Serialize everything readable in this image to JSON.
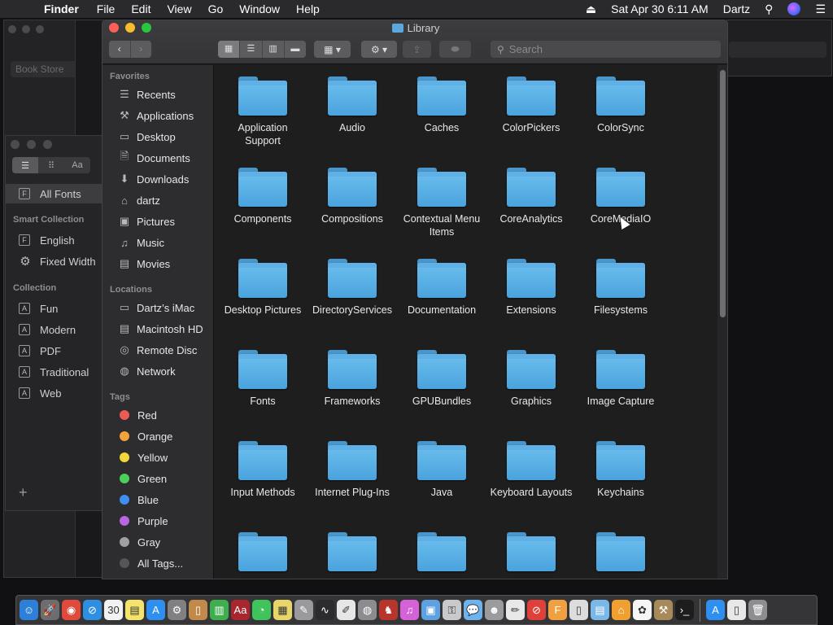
{
  "menubar": {
    "apple": "",
    "app_name": "Finder",
    "menus": [
      "File",
      "Edit",
      "View",
      "Go",
      "Window",
      "Help"
    ],
    "clock": "Sat Apr 30  6:11 AM",
    "user": "Dartz"
  },
  "bookstore": {
    "search_placeholder": "Book Store"
  },
  "fontbook": {
    "segments": [
      "☰",
      "⠿",
      "Aa"
    ],
    "all_fonts": "All Fonts",
    "smart_header": "Smart Collection",
    "smart_items": [
      "English",
      "Fixed Width"
    ],
    "collection_header": "Collection",
    "collection_items": [
      "Fun",
      "Modern",
      "PDF",
      "Traditional",
      "Web"
    ],
    "add": "+"
  },
  "finder": {
    "title": "Library",
    "nav_back": "‹",
    "nav_forward": "›",
    "view_modes": [
      "▦",
      "☰",
      "▥",
      "▬"
    ],
    "group_btn": "▦ ▾",
    "action_btn": "⚙ ▾",
    "share_btn": "⇪",
    "tag_btn": "⬬",
    "search_placeholder": "Search",
    "sidebar": {
      "favorites_header": "Favorites",
      "favorites": [
        {
          "label": "Recents",
          "icon": "☰"
        },
        {
          "label": "Applications",
          "icon": "⚒"
        },
        {
          "label": "Desktop",
          "icon": "▭"
        },
        {
          "label": "Documents",
          "icon": "🗎"
        },
        {
          "label": "Downloads",
          "icon": "⬇"
        },
        {
          "label": "dartz",
          "icon": "⌂"
        },
        {
          "label": "Pictures",
          "icon": "▣"
        },
        {
          "label": "Music",
          "icon": "♫"
        },
        {
          "label": "Movies",
          "icon": "▤"
        }
      ],
      "locations_header": "Locations",
      "locations": [
        {
          "label": "Dartz’s iMac",
          "icon": "▭"
        },
        {
          "label": "Macintosh HD",
          "icon": "▤"
        },
        {
          "label": "Remote Disc",
          "icon": "◎"
        },
        {
          "label": "Network",
          "icon": "◍"
        }
      ],
      "tags_header": "Tags",
      "tags": [
        {
          "label": "Red",
          "color": "#ee5b55"
        },
        {
          "label": "Orange",
          "color": "#f4a33b"
        },
        {
          "label": "Yellow",
          "color": "#f2d63a"
        },
        {
          "label": "Green",
          "color": "#4ccf58"
        },
        {
          "label": "Blue",
          "color": "#3f8ef1"
        },
        {
          "label": "Purple",
          "color": "#b867e0"
        },
        {
          "label": "Gray",
          "color": "#a0a0a0"
        },
        {
          "label": "All Tags...",
          "color": "#555557"
        }
      ]
    },
    "folders": [
      "Application Support",
      "Audio",
      "Caches",
      "ColorPickers",
      "ColorSync",
      "Components",
      "Compositions",
      "Contextual Menu Items",
      "CoreAnalytics",
      "CoreMediaIO",
      "Desktop Pictures",
      "DirectoryServices",
      "Documentation",
      "Extensions",
      "Filesystems",
      "Fonts",
      "Frameworks",
      "GPUBundles",
      "Graphics",
      "Image Capture",
      "Input Methods",
      "Internet Plug-Ins",
      "Java",
      "Keyboard Layouts",
      "Keychains",
      "",
      "",
      "",
      "",
      ""
    ]
  },
  "dock": {
    "apps": [
      {
        "name": "finder-icon",
        "color": "#2d7fd8",
        "glyph": "☺"
      },
      {
        "name": "launchpad-icon",
        "color": "#6d6d70",
        "glyph": "🚀"
      },
      {
        "name": "chrome-icon",
        "color": "#e04a3c",
        "glyph": "◉"
      },
      {
        "name": "safari-icon",
        "color": "#2e8fe0",
        "glyph": "⊘"
      },
      {
        "name": "calendar-icon",
        "color": "#f2f2f2",
        "glyph": "30"
      },
      {
        "name": "notes-icon",
        "color": "#f5e46b",
        "glyph": "▤"
      },
      {
        "name": "app-store-icon",
        "color": "#2f8ff0",
        "glyph": "A"
      },
      {
        "name": "system-preferences-icon",
        "color": "#808083",
        "glyph": "⚙"
      },
      {
        "name": "ibooks-icon",
        "color": "#c28a4a",
        "glyph": "▯"
      },
      {
        "name": "numbers-icon",
        "color": "#3fae4e",
        "glyph": "▥"
      },
      {
        "name": "dictionary-icon",
        "color": "#a8262d",
        "glyph": "Aa"
      },
      {
        "name": "messages-icon",
        "color": "#41c35c",
        "glyph": "◔"
      },
      {
        "name": "stickies-icon",
        "color": "#e8d66a",
        "glyph": "▦"
      },
      {
        "name": "script-editor-icon",
        "color": "#9a9a9d",
        "glyph": "✎"
      },
      {
        "name": "activity-monitor-icon",
        "color": "#2c2c2e",
        "glyph": "∿"
      },
      {
        "name": "textedit-icon",
        "color": "#e6e6e6",
        "glyph": "✐"
      },
      {
        "name": "disk-utility-icon",
        "color": "#8c8c90",
        "glyph": "◍"
      },
      {
        "name": "chess-icon",
        "color": "#b8352e",
        "glyph": "♞"
      },
      {
        "name": "itunes-icon",
        "color": "#d562d9",
        "glyph": "♫"
      },
      {
        "name": "preview-icon",
        "color": "#5da1e0",
        "glyph": "▣"
      },
      {
        "name": "keychain-icon",
        "color": "#c9c9cc",
        "glyph": "⚿"
      },
      {
        "name": "feedback-icon",
        "color": "#6db4ef",
        "glyph": "💬"
      },
      {
        "name": "automator-icon",
        "color": "#9b9b9e",
        "glyph": "☻"
      },
      {
        "name": "pencil-icon",
        "color": "#e8e8e8",
        "glyph": "✏"
      },
      {
        "name": "no-entry-icon",
        "color": "#e0403a",
        "glyph": "⊘"
      },
      {
        "name": "font-book-icon",
        "color": "#f0a040",
        "glyph": "F"
      },
      {
        "name": "document-icon",
        "color": "#dcdcdc",
        "glyph": "▯"
      },
      {
        "name": "folder-stack-icon",
        "color": "#7ab8ea",
        "glyph": "▤"
      },
      {
        "name": "home-icon",
        "color": "#f0a030",
        "glyph": "⌂"
      },
      {
        "name": "photos-icon",
        "color": "#f5f5f5",
        "glyph": "✿"
      },
      {
        "name": "grapher-icon",
        "color": "#a88a5a",
        "glyph": "⚒"
      },
      {
        "name": "terminal-icon",
        "color": "#1d1d1d",
        "glyph": "›_"
      }
    ],
    "trailing": [
      {
        "name": "app-store-dock-icon",
        "color": "#2f8ff0",
        "glyph": "A"
      },
      {
        "name": "file-icon",
        "color": "#e8e8e8",
        "glyph": "▯"
      },
      {
        "name": "trash-icon",
        "color": "#8e8e91",
        "glyph": "🗑"
      }
    ]
  }
}
